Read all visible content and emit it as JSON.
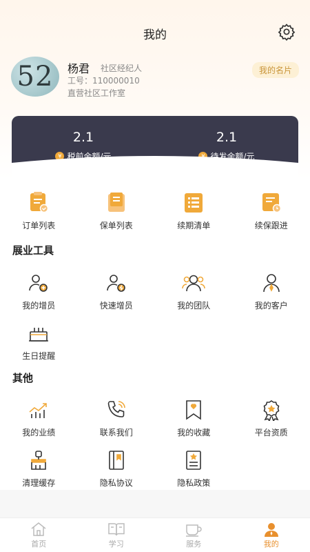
{
  "header": {
    "title": "我的",
    "settings_icon": "gear-icon"
  },
  "profile": {
    "avatar_text": "52",
    "name": "杨君",
    "role": "社区经纪人",
    "employee_id": "工号：110000010",
    "org": "直营社区工作室",
    "card_button": "我的名片"
  },
  "balance": {
    "pre_tax_value": "2.1",
    "pre_tax_label": "税前余额/元",
    "pending_value": "2.1",
    "pending_label": "待发余额/元"
  },
  "orders": [
    {
      "label": "订单列表",
      "icon": "order-list-icon"
    },
    {
      "label": "保单列表",
      "icon": "policy-list-icon"
    },
    {
      "label": "续期清单",
      "icon": "renewal-list-icon"
    },
    {
      "label": "续保跟进",
      "icon": "renewal-followup-icon"
    }
  ],
  "tools": {
    "title": "展业工具",
    "items": [
      {
        "label": "我的增员",
        "icon": "add-member-icon"
      },
      {
        "label": "快速增员",
        "icon": "quick-add-member-icon"
      },
      {
        "label": "我的团队",
        "icon": "team-icon"
      },
      {
        "label": "我的客户",
        "icon": "customer-icon"
      },
      {
        "label": "生日提醒",
        "icon": "birthday-cake-icon"
      }
    ]
  },
  "other": {
    "title": "其他",
    "items": [
      {
        "label": "我的业绩",
        "icon": "performance-chart-icon"
      },
      {
        "label": "联系我们",
        "icon": "phone-icon"
      },
      {
        "label": "我的收藏",
        "icon": "bookmark-icon"
      },
      {
        "label": "平台资质",
        "icon": "award-badge-icon"
      },
      {
        "label": "清理缓存",
        "icon": "broom-icon"
      },
      {
        "label": "隐私协议",
        "icon": "privacy-agreement-icon"
      },
      {
        "label": "隐私政策",
        "icon": "privacy-policy-icon"
      }
    ]
  },
  "tabbar": {
    "tabs": [
      {
        "label": "首页",
        "icon": "home-icon",
        "active": false
      },
      {
        "label": "学习",
        "icon": "book-icon",
        "active": false
      },
      {
        "label": "服务",
        "icon": "cup-icon",
        "active": false
      },
      {
        "label": "我的",
        "icon": "user-icon",
        "active": true
      }
    ]
  },
  "colors": {
    "accent": "#e8902e",
    "card_bg": "#3a3a4d",
    "coin": "#f0a93a"
  }
}
